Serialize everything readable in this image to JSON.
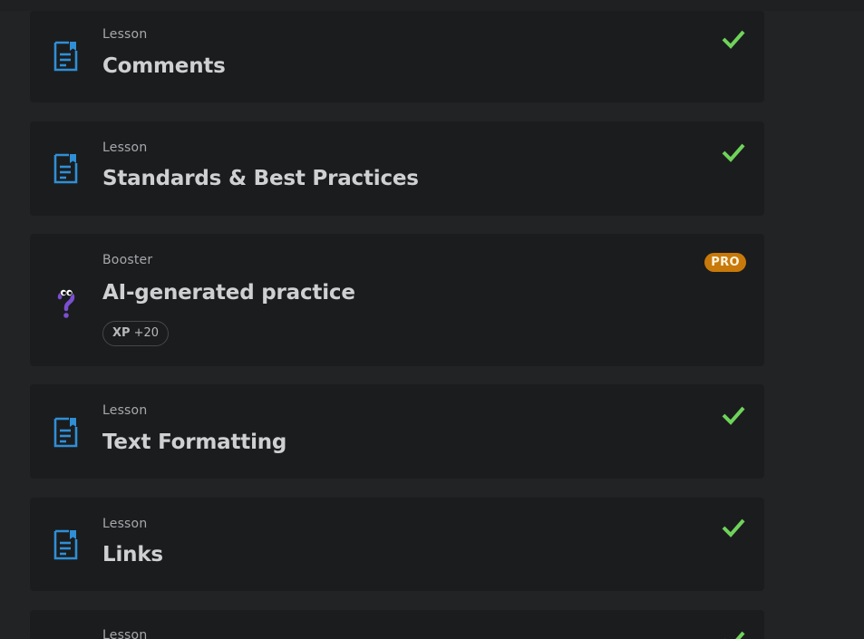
{
  "colors": {
    "background": "#222324",
    "card": "#1b1c1e",
    "lesson_icon": "#2f8fd6",
    "check": "#6fd35a",
    "booster_icon": "#7a4fd0",
    "pro_badge": "#c7790a"
  },
  "items": [
    {
      "kind": "Lesson",
      "title": "Comments",
      "icon": "lesson-document-icon",
      "status": "completed"
    },
    {
      "kind": "Lesson",
      "title": "Standards & Best Practices",
      "icon": "lesson-document-icon",
      "status": "completed"
    },
    {
      "kind": "Booster",
      "title": "AI-generated practice",
      "icon": "question-mark-mascot-icon",
      "badge": "PRO",
      "xp_label": "XP",
      "xp_value": "+20"
    },
    {
      "kind": "Lesson",
      "title": "Text Formatting",
      "icon": "lesson-document-icon",
      "status": "completed"
    },
    {
      "kind": "Lesson",
      "title": "Links",
      "icon": "lesson-document-icon",
      "status": "completed"
    },
    {
      "kind": "Lesson",
      "title": "",
      "icon": "lesson-document-icon",
      "status": "completed"
    }
  ]
}
